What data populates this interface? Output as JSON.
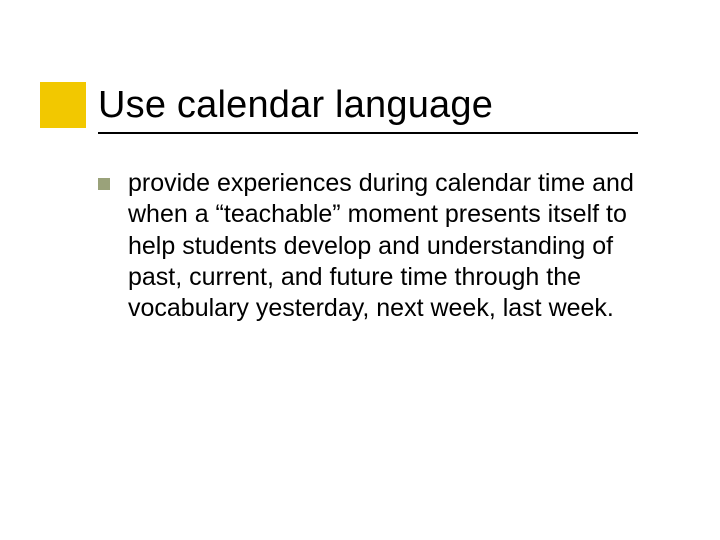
{
  "colors": {
    "accent": "#f2c800",
    "bullet": "#9aa27a",
    "text": "#000000",
    "background": "#ffffff"
  },
  "slide": {
    "title": "Use calendar language",
    "bullets": [
      {
        "text": "provide experiences during calendar time and when a “teachable” moment presents itself to help students develop and understanding of past, current, and future time through the vocabulary yesterday, next week, last week."
      }
    ]
  }
}
